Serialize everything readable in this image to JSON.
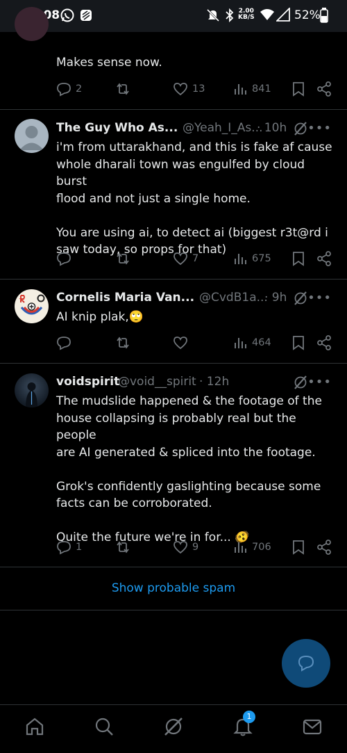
{
  "status_bar": {
    "time": "15:08",
    "net_speed_value": "2.00",
    "net_speed_unit": "KB/S",
    "battery": "52%"
  },
  "top_post": {
    "text": "Makes sense now.",
    "replies": "2",
    "reposts": "",
    "likes": "13",
    "views": "841"
  },
  "posts": [
    {
      "name": "The Guy Who As...",
      "handle": "@Yeah_I_As...",
      "time": "· 10h",
      "text_lines": [
        "i'm from uttarakhand, and this is fake af cause",
        "whole dharali town was engulfed by cloud burst",
        "flood and not just a single home.",
        "",
        "You are using ai, to detect ai (biggest r3t@rd i",
        "saw today, so props for that)"
      ],
      "replies": "",
      "reposts": "",
      "likes": "7",
      "views": "675"
    },
    {
      "name": "Cornelis Maria Van...",
      "handle": "@CvdB1a...",
      "time": "· 9h",
      "text_lines": [
        "AI knip plak,🙄"
      ],
      "replies": "",
      "reposts": "",
      "likes": "",
      "views": "464"
    },
    {
      "name": "voidspirit",
      "handle": "@void__spirit",
      "time": "· 12h",
      "text_lines": [
        "The mudslide happened & the footage of the",
        "house collapsing is probably real but the people",
        "are AI generated & spliced into the footage.",
        "",
        "Grok's confidently gaslighting because some",
        "facts can be corroborated.",
        "",
        "Quite the future we're in for... 🫨"
      ],
      "replies": "1",
      "reposts": "",
      "likes": "9",
      "views": "706"
    }
  ],
  "spam_link": "Show probable spam",
  "notification_count": "1",
  "colors": {
    "background": "#000000",
    "text": "#e7e9ea",
    "muted": "#71767b",
    "accent": "#1d9bf0",
    "divider": "#2f3336",
    "fab": "#0f4a78"
  },
  "icons": [
    "reply-icon",
    "repost-icon",
    "like-icon",
    "views-icon",
    "bookmark-icon",
    "share-icon",
    "grok-icon",
    "more-icon",
    "home-icon",
    "search-icon",
    "notifications-icon",
    "messages-icon",
    "compose-icon"
  ]
}
